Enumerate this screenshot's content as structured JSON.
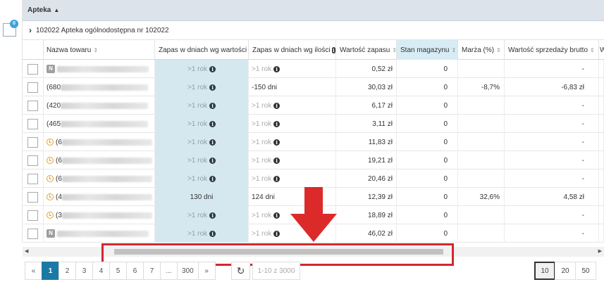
{
  "group": {
    "header": "Apteka",
    "row_label": "102022 Apteka ogólnodostępna nr 102022",
    "badge": "0"
  },
  "columns": [
    "Nazwa towaru",
    "Zapas w dniach wg wartości",
    "Zapas w dniach wg ilości",
    "Wartość zapasu",
    "Stan magazynu",
    "Marża (%)",
    "Wartość sprzedaży brutto",
    "W"
  ],
  "rows": [
    {
      "prefix": "N",
      "name_start": "",
      "zv": ">1 rok",
      "zv_info": true,
      "zi": ">1 rok",
      "zi_info": true,
      "zi_dark": false,
      "wz": "0,52 zł",
      "sm": "0",
      "mz": "",
      "ws": "-"
    },
    {
      "prefix": "",
      "name_start": "(680",
      "zv": ">1 rok",
      "zv_info": true,
      "zi": "-150 dni",
      "zi_info": false,
      "zi_dark": true,
      "wz": "30,03 zł",
      "sm": "0",
      "mz": "-8,7%",
      "ws": "-6,83 zł"
    },
    {
      "prefix": "",
      "name_start": "(420",
      "zv": ">1 rok",
      "zv_info": true,
      "zi": ">1 rok",
      "zi_info": true,
      "zi_dark": false,
      "wz": "6,17 zł",
      "sm": "0",
      "mz": "",
      "ws": "-"
    },
    {
      "prefix": "",
      "name_start": "(465",
      "zv": ">1 rok",
      "zv_info": true,
      "zi": ">1 rok",
      "zi_info": true,
      "zi_dark": false,
      "wz": "3,11 zł",
      "sm": "0",
      "mz": "",
      "ws": "-"
    },
    {
      "prefix": "clock",
      "name_start": "(6",
      "zv": ">1 rok",
      "zv_info": true,
      "zi": ">1 rok",
      "zi_info": true,
      "zi_dark": false,
      "wz": "11,83 zł",
      "sm": "0",
      "mz": "",
      "ws": "-"
    },
    {
      "prefix": "clock",
      "name_start": "(6",
      "zv": ">1 rok",
      "zv_info": true,
      "zi": ">1 rok",
      "zi_info": true,
      "zi_dark": false,
      "wz": "19,21 zł",
      "sm": "0",
      "mz": "",
      "ws": "-"
    },
    {
      "prefix": "clock",
      "name_start": "(6",
      "zv": ">1 rok",
      "zv_info": true,
      "zi": ">1 rok",
      "zi_info": true,
      "zi_dark": false,
      "wz": "20,46 zł",
      "sm": "0",
      "mz": "",
      "ws": "-"
    },
    {
      "prefix": "clock",
      "name_start": "(4",
      "zv": "130 dni",
      "zv_info": false,
      "zi": "124 dni",
      "zi_info": false,
      "zi_dark": true,
      "wz": "12,39 zł",
      "sm": "0",
      "mz": "32,6%",
      "ws": "4,58 zł"
    },
    {
      "prefix": "clock",
      "name_start": "(3",
      "zv": ">1 rok",
      "zv_info": true,
      "zi": ">1 rok",
      "zi_info": true,
      "zi_dark": false,
      "wz": "18,89 zł",
      "sm": "0",
      "mz": "",
      "ws": "-"
    },
    {
      "prefix": "N",
      "name_start": "",
      "zv": ">1 rok",
      "zv_info": true,
      "zi": ">1 rok",
      "zi_info": true,
      "zi_dark": false,
      "wz": "46,02 zł",
      "sm": "0",
      "mz": "",
      "ws": "-"
    }
  ],
  "pager": {
    "first": "«",
    "pages": [
      "1",
      "2",
      "3",
      "4",
      "5",
      "6",
      "7",
      "...",
      "300"
    ],
    "next": "»",
    "range": "1-10 z 3000",
    "sizes": [
      "10",
      "20",
      "50"
    ],
    "active_size": "10"
  },
  "colors": {
    "highlight": "#d4262e",
    "active_page": "#1a7aa6",
    "value_column": "#d6e8ef"
  }
}
